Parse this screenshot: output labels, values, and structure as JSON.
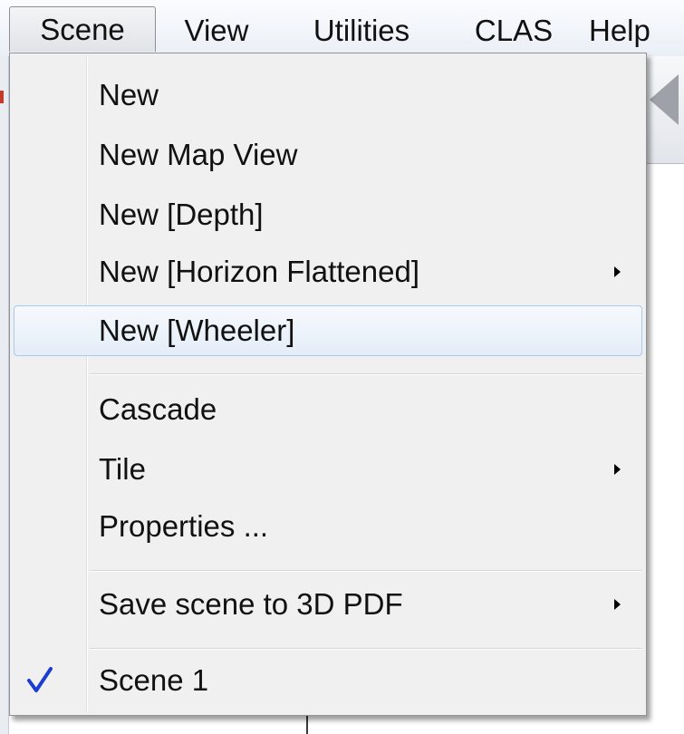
{
  "menubar": {
    "items": [
      {
        "label": "Scene"
      },
      {
        "label": "View"
      },
      {
        "label": "Utilities"
      },
      {
        "label": "CLAS"
      },
      {
        "label": "Help"
      }
    ]
  },
  "scene_menu": {
    "items": [
      {
        "label": "New"
      },
      {
        "label": "New Map View"
      },
      {
        "label": "New [Depth]"
      },
      {
        "label": "New [Horizon Flattened]",
        "has_submenu": true
      },
      {
        "label": "New [Wheeler]",
        "highlighted": true
      },
      {
        "label": "Cascade"
      },
      {
        "label": "Tile",
        "has_submenu": true
      },
      {
        "label": "Properties ..."
      },
      {
        "label": "Save scene to 3D PDF",
        "has_submenu": true
      },
      {
        "label": "Scene 1",
        "checked": true
      }
    ]
  },
  "colors": {
    "highlight_border": "#a8c8ec",
    "check": "#1a3fd0"
  }
}
